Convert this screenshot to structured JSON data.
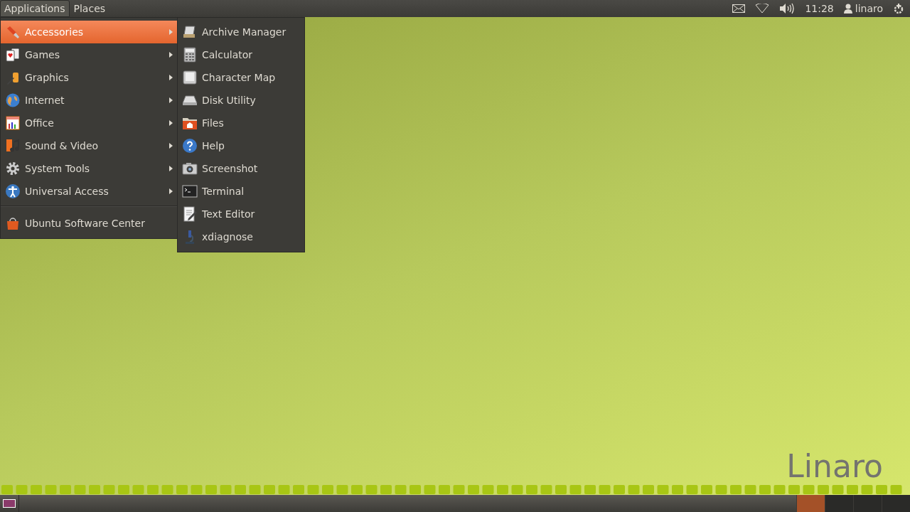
{
  "top_panel": {
    "menus": [
      {
        "label": "Applications",
        "selected": true
      },
      {
        "label": "Places",
        "selected": false
      }
    ],
    "clock": "11:28",
    "user": "linaro"
  },
  "applications_menu": {
    "items": [
      {
        "kind": "category",
        "label": "Accessories",
        "selected": true
      },
      {
        "kind": "category",
        "label": "Games",
        "selected": false
      },
      {
        "kind": "category",
        "label": "Graphics",
        "selected": false
      },
      {
        "kind": "category",
        "label": "Internet",
        "selected": false
      },
      {
        "kind": "category",
        "label": "Office",
        "selected": false
      },
      {
        "kind": "category",
        "label": "Sound & Video",
        "selected": false
      },
      {
        "kind": "category",
        "label": "System Tools",
        "selected": false
      },
      {
        "kind": "category",
        "label": "Universal Access",
        "selected": false
      },
      {
        "kind": "separator"
      },
      {
        "kind": "app",
        "label": "Ubuntu Software Center",
        "selected": false
      }
    ]
  },
  "accessories_submenu": {
    "items": [
      {
        "label": "Archive Manager"
      },
      {
        "label": "Calculator"
      },
      {
        "label": "Character Map"
      },
      {
        "label": "Disk Utility"
      },
      {
        "label": "Files"
      },
      {
        "label": "Help"
      },
      {
        "label": "Screenshot"
      },
      {
        "label": "Terminal"
      },
      {
        "label": "Text Editor"
      },
      {
        "label": "xdiagnose"
      }
    ]
  },
  "wallpaper": {
    "logo": "Linaro"
  },
  "bottom_panel": {
    "workspaces": [
      {
        "selected": true
      },
      {
        "selected": false
      },
      {
        "selected": false
      },
      {
        "selected": false
      }
    ]
  }
}
